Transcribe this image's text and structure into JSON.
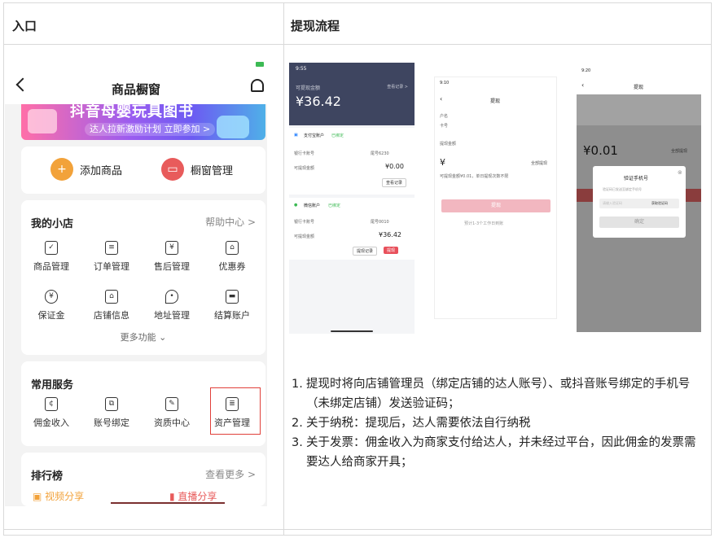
{
  "headers": {
    "left": "入口",
    "right": "提现流程"
  },
  "phone": {
    "title": "商品橱窗",
    "banner": {
      "title": "抖音母婴玩具图书",
      "subtitle": "达人拉新激励计划 立即参加 >"
    },
    "quick_actions": [
      {
        "label": "添加商品",
        "icon": "plus-bag-icon",
        "color": "#f2a23a"
      },
      {
        "label": "橱窗管理",
        "icon": "window-icon",
        "color": "#e85b5b"
      }
    ],
    "shop": {
      "title": "我的小店",
      "link": "帮助中心 >",
      "items": [
        "商品管理",
        "订单管理",
        "售后管理",
        "优惠券",
        "保证金",
        "店铺信息",
        "地址管理",
        "结算账户"
      ],
      "more": "更多功能"
    },
    "services": {
      "title": "常用服务",
      "items": [
        "佣金收入",
        "账号绑定",
        "资质中心",
        "资产管理"
      ]
    },
    "ranking": {
      "title": "排行榜",
      "link": "查看更多 >",
      "tabs": [
        "视频分享",
        "直播分享"
      ]
    }
  },
  "screens": {
    "s1": {
      "time": "9:55",
      "label": "可提现金额",
      "amount": "¥36.42",
      "link": "查看记录 >",
      "alipay": {
        "name": "支付宝账户",
        "tag": "已绑定",
        "row1_label": "银行卡账号",
        "row1_value": "尾号6230",
        "row2_label": "可提现金额",
        "row2_value": "¥0.00",
        "btn": "查看记录"
      },
      "wechat": {
        "name": "微信账户",
        "tag": "已绑定",
        "row1_label": "银行卡账号",
        "row1_value": "尾号0010",
        "row2_label": "可提现金额",
        "row2_value": "¥36.42",
        "btn1": "提现记录",
        "btn2": "提现"
      }
    },
    "s2": {
      "time": "9:10",
      "title": "提现",
      "row1": "户名",
      "row2": "卡号",
      "amount_label": "提现金额",
      "currency": "¥",
      "all": "全部提现",
      "hint": "可提现金额¥0.01，单日提现次数不限",
      "button": "提现",
      "note": "预计1-3个工作日到账"
    },
    "s3": {
      "time": "9:20",
      "title": "提现",
      "amount": "¥0.01",
      "all": "全部提现",
      "dialog_title": "验证手机号",
      "dialog_sub": "验证码已发送至绑定手机号",
      "input_placeholder": "请输入验证码",
      "get_code": "获取验证码",
      "confirm": "确定"
    }
  },
  "notes": [
    {
      "num": "1.",
      "text": "提现时将向店铺管理员（绑定店铺的达人账号）、或抖音账号绑定的手机号（未绑定店铺）发送验证码；"
    },
    {
      "num": "2.",
      "text": "关于纳税：提现后，达人需要依法自行纳税"
    },
    {
      "num": "3.",
      "text": "关于发票：佣金收入为商家支付给达人，并未经过平台，因此佣金的发票需要达人给商家开具；"
    }
  ],
  "colors": {
    "accent_red": "#e0403a",
    "dark_header": "#3e4560",
    "pink_button": "#f2b7c0"
  }
}
